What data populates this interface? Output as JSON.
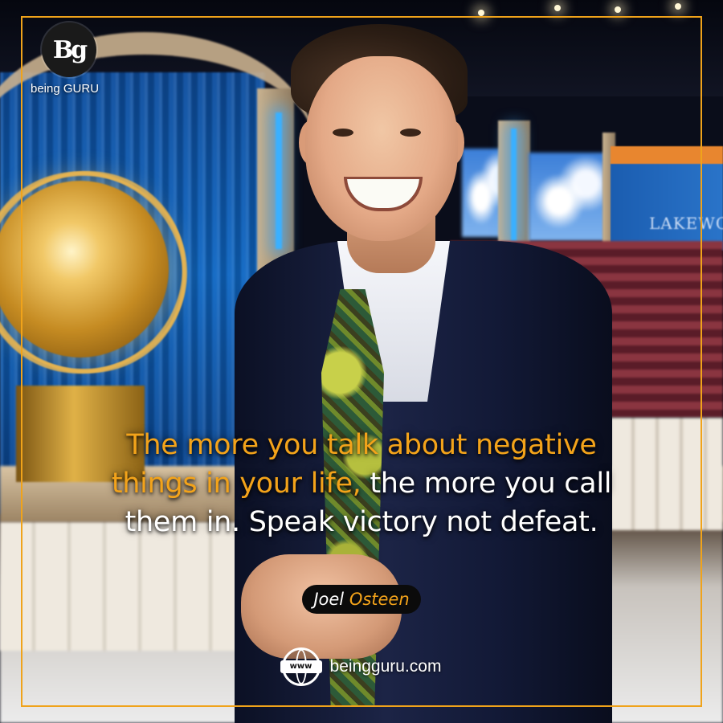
{
  "brand": {
    "logo_mark": "Bg",
    "name": "being GURU"
  },
  "background_sign": "LAKEWO",
  "quote": {
    "highlight": "The more you talk about negative things in your life,",
    "rest": " the more you call them in. Speak victory not defeat."
  },
  "author": {
    "first": "Joel ",
    "last": "Osteen"
  },
  "footer": {
    "icon_label": "www",
    "website": "beingguru.com"
  },
  "colors": {
    "accent": "#f3a31a",
    "frame": "#f0a31a",
    "text": "#ffffff"
  }
}
